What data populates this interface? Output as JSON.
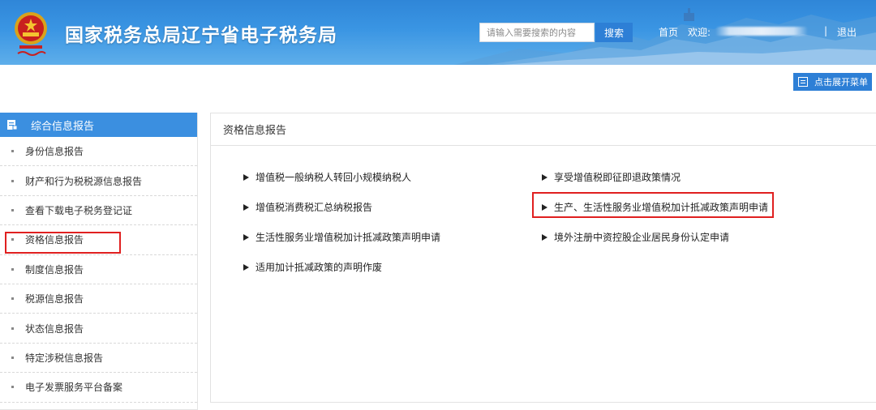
{
  "header": {
    "site_title": "国家税务总局辽宁省电子税务局",
    "search_placeholder": "请输入需要搜索的内容",
    "search_button": "搜索",
    "home_link": "首页",
    "welcome": "欢迎:",
    "separator": "|",
    "logout": "退出"
  },
  "toolbar": {
    "expand_menu": "点击展开菜单"
  },
  "sidebar": {
    "title": "综合信息报告",
    "items": [
      {
        "label": "身份信息报告"
      },
      {
        "label": "财产和行为税税源信息报告"
      },
      {
        "label": "查看下载电子税务登记证"
      },
      {
        "label": "资格信息报告"
      },
      {
        "label": "制度信息报告"
      },
      {
        "label": "税源信息报告"
      },
      {
        "label": "状态信息报告"
      },
      {
        "label": "特定涉税信息报告"
      },
      {
        "label": "电子发票服务平台备案"
      }
    ]
  },
  "main": {
    "title": "资格信息报告",
    "left_links": [
      {
        "label": "增值税一般纳税人转回小规模纳税人"
      },
      {
        "label": "增值税消费税汇总纳税报告"
      },
      {
        "label": "生活性服务业增值税加计抵减政策声明申请"
      },
      {
        "label": "适用加计抵减政策的声明作废"
      }
    ],
    "right_links": [
      {
        "label": "享受增值税即征即退政策情况"
      },
      {
        "label": "生产、生活性服务业增值税加计抵减政策声明申请"
      },
      {
        "label": "境外注册中资控股企业居民身份认定申请"
      }
    ]
  },
  "colors": {
    "brand_blue": "#2d7fd6",
    "sidebar_header": "#3b8fe0",
    "highlight_red": "#e02020"
  },
  "icons": {
    "emblem": "tax-emblem-icon",
    "menu": "menu-icon",
    "sidebar_header": "document-icon",
    "link_marker": "triangle-right-icon"
  }
}
